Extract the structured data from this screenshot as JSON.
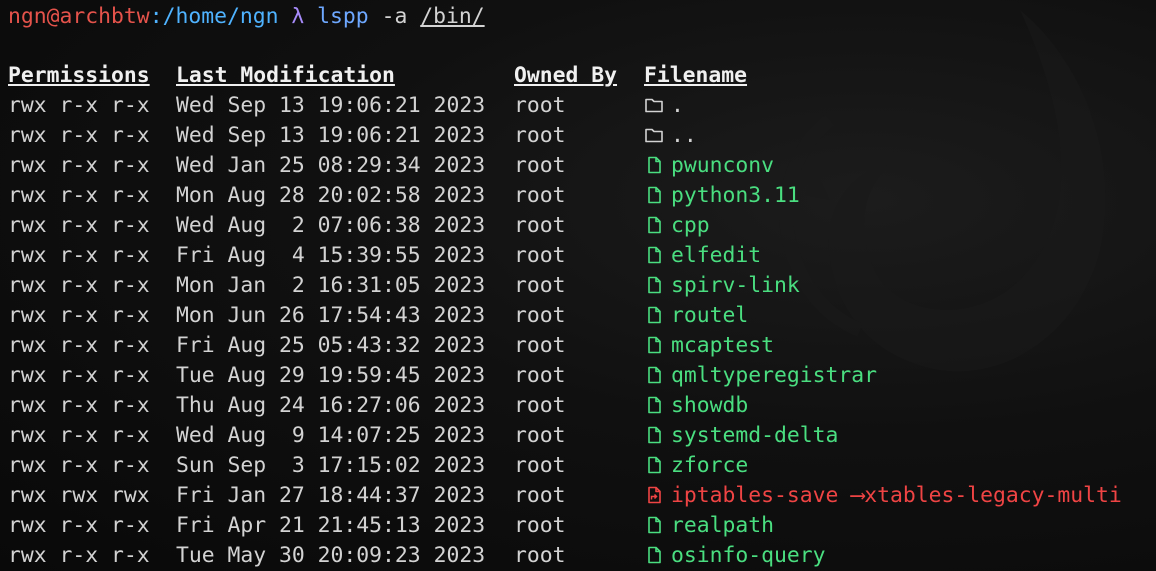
{
  "prompt": {
    "user": "ngn",
    "at": "@",
    "host": "archbtw",
    "colon": ":",
    "path": "/home/ngn",
    "lambda": "λ",
    "command": "lspp",
    "flag": "-a",
    "target": "/bin/"
  },
  "headers": {
    "permissions": "Permissions",
    "last_modification": "Last Modification",
    "owned_by": "Owned By",
    "filename": "Filename"
  },
  "colors": {
    "executable": "#4ade80",
    "symlink": "#ef4444",
    "directory": "#d3d3d3"
  },
  "rows": [
    {
      "perm": "rwx r-x r-x",
      "date": "Wed Sep 13 19:06:21 2023",
      "owner": "root",
      "name": ".",
      "type": "dir",
      "icon": "folder-icon"
    },
    {
      "perm": "rwx r-x r-x",
      "date": "Wed Sep 13 19:06:21 2023",
      "owner": "root",
      "name": "..",
      "type": "dir",
      "icon": "folder-icon"
    },
    {
      "perm": "rwx r-x r-x",
      "date": "Wed Jan 25 08:29:34 2023",
      "owner": "root",
      "name": "pwunconv",
      "type": "exe",
      "icon": "file-icon"
    },
    {
      "perm": "rwx r-x r-x",
      "date": "Mon Aug 28 20:02:58 2023",
      "owner": "root",
      "name": "python3.11",
      "type": "exe",
      "icon": "file-icon"
    },
    {
      "perm": "rwx r-x r-x",
      "date": "Wed Aug  2 07:06:38 2023",
      "owner": "root",
      "name": "cpp",
      "type": "exe",
      "icon": "file-icon"
    },
    {
      "perm": "rwx r-x r-x",
      "date": "Fri Aug  4 15:39:55 2023",
      "owner": "root",
      "name": "elfedit",
      "type": "exe",
      "icon": "file-icon"
    },
    {
      "perm": "rwx r-x r-x",
      "date": "Mon Jan  2 16:31:05 2023",
      "owner": "root",
      "name": "spirv-link",
      "type": "exe",
      "icon": "file-icon"
    },
    {
      "perm": "rwx r-x r-x",
      "date": "Mon Jun 26 17:54:43 2023",
      "owner": "root",
      "name": "routel",
      "type": "exe",
      "icon": "file-icon"
    },
    {
      "perm": "rwx r-x r-x",
      "date": "Fri Aug 25 05:43:32 2023",
      "owner": "root",
      "name": "mcaptest",
      "type": "exe",
      "icon": "file-icon"
    },
    {
      "perm": "rwx r-x r-x",
      "date": "Tue Aug 29 19:59:45 2023",
      "owner": "root",
      "name": "qmltyperegistrar",
      "type": "exe",
      "icon": "file-icon"
    },
    {
      "perm": "rwx r-x r-x",
      "date": "Thu Aug 24 16:27:06 2023",
      "owner": "root",
      "name": "showdb",
      "type": "exe",
      "icon": "file-icon"
    },
    {
      "perm": "rwx r-x r-x",
      "date": "Wed Aug  9 14:07:25 2023",
      "owner": "root",
      "name": "systemd-delta",
      "type": "exe",
      "icon": "file-icon"
    },
    {
      "perm": "rwx r-x r-x",
      "date": "Sun Sep  3 17:15:02 2023",
      "owner": "root",
      "name": "zforce",
      "type": "exe",
      "icon": "file-icon"
    },
    {
      "perm": "rwx rwx rwx",
      "date": "Fri Jan 27 18:44:37 2023",
      "owner": "root",
      "name": "iptables-save",
      "type": "link",
      "icon": "symlink-file-icon",
      "arrow": "⟶",
      "target": "xtables-legacy-multi"
    },
    {
      "perm": "rwx r-x r-x",
      "date": "Fri Apr 21 21:45:13 2023",
      "owner": "root",
      "name": "realpath",
      "type": "exe",
      "icon": "file-icon"
    },
    {
      "perm": "rwx r-x r-x",
      "date": "Tue May 30 20:09:23 2023",
      "owner": "root",
      "name": "osinfo-query",
      "type": "exe",
      "icon": "file-icon"
    }
  ]
}
